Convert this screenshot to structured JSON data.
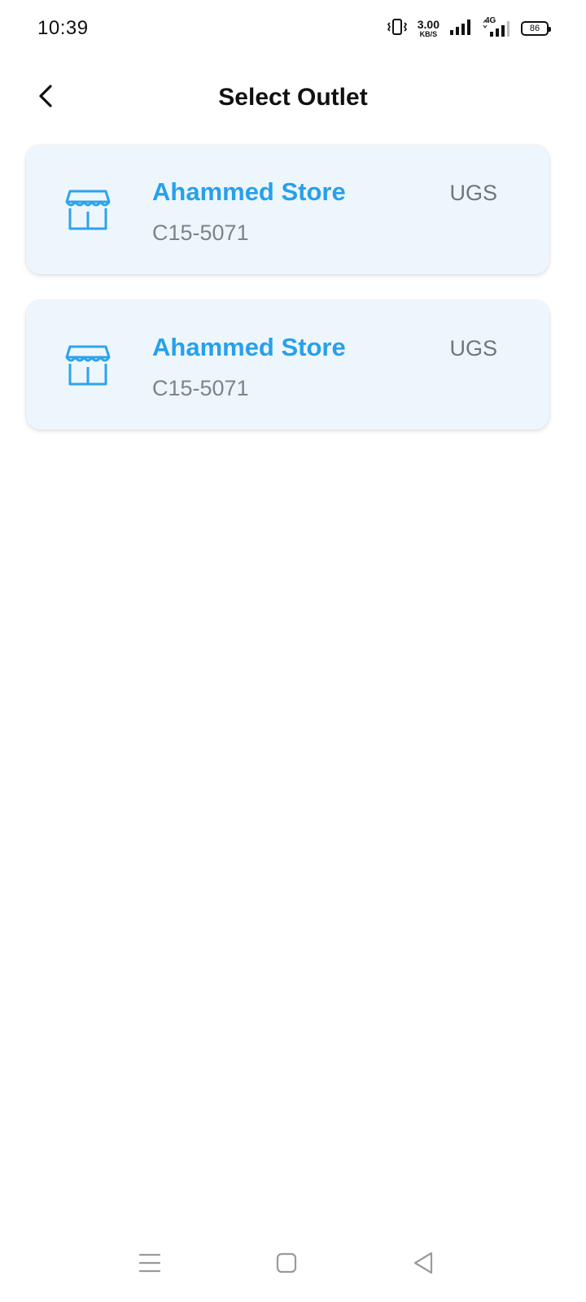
{
  "status_bar": {
    "time": "10:39",
    "net_speed_value": "3.00",
    "net_speed_unit": "KB/S",
    "network_type": "4G",
    "battery_level": "86",
    "icons": [
      "vibrate-icon",
      "signal-icon",
      "signal-4g-icon",
      "battery-icon"
    ]
  },
  "header": {
    "title": "Select Outlet",
    "back_icon": "chevron-left-icon"
  },
  "outlets": [
    {
      "name": "Ahammed Store",
      "code": "C15-5071",
      "type": "UGS",
      "icon": "store-icon"
    },
    {
      "name": "Ahammed Store",
      "code": "C15-5071",
      "type": "UGS",
      "icon": "store-icon"
    }
  ],
  "nav_bar": {
    "icons": [
      "menu-icon",
      "home-icon",
      "back-triangle-icon"
    ]
  },
  "colors": {
    "accent": "#27a0ec",
    "card_bg": "#eef6fd",
    "muted_text": "#7d8389"
  }
}
